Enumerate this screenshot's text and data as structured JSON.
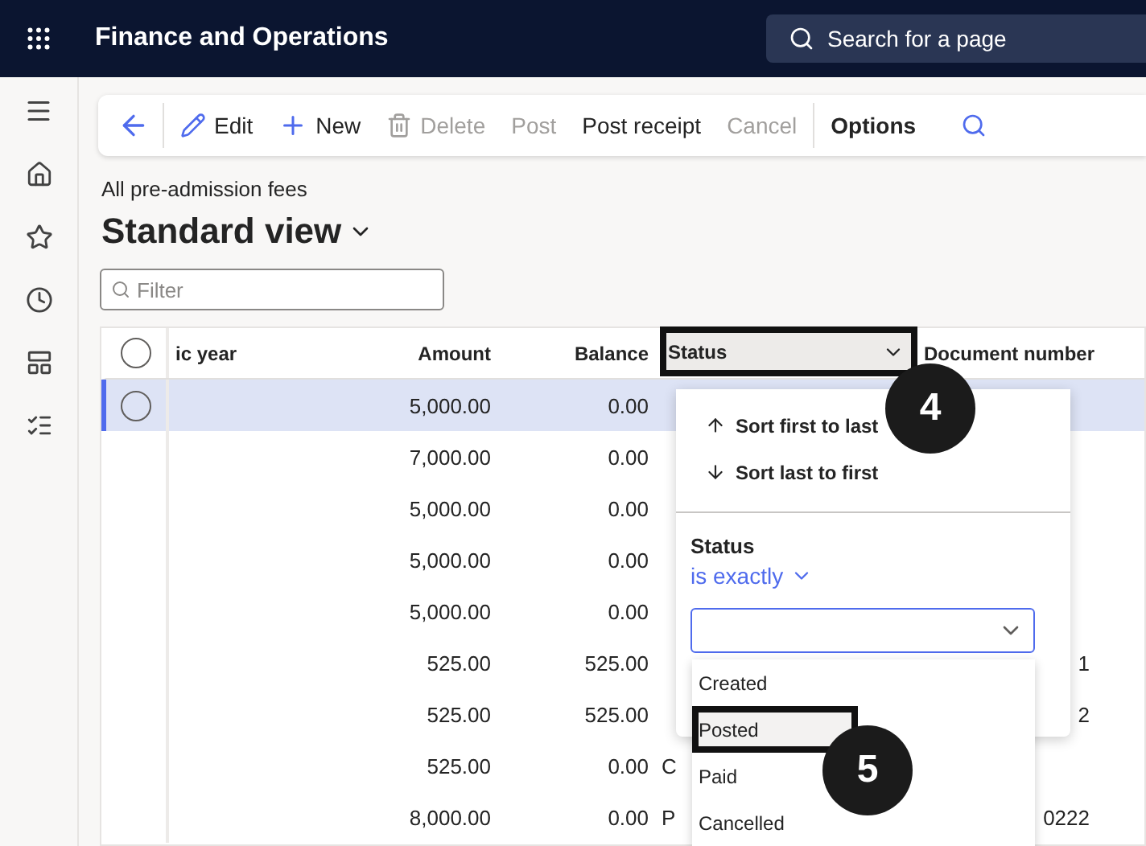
{
  "app_bar": {
    "title": "Finance and Operations",
    "search": {
      "placeholder": "Search for a page"
    }
  },
  "toolbar": {
    "buttons": [
      {
        "label": "Edit",
        "disabled": false
      },
      {
        "label": "New",
        "disabled": false
      },
      {
        "label": "Delete",
        "disabled": true
      },
      {
        "label": "Post",
        "disabled": true
      },
      {
        "label": "Post receipt",
        "disabled": false
      },
      {
        "label": "Cancel",
        "disabled": true
      }
    ],
    "options": "Options"
  },
  "breadcrumb": "All pre-admission fees",
  "view_title": "Standard view",
  "filter": {
    "placeholder": "Filter"
  },
  "grid": {
    "all_selected": false,
    "columns": [
      "ic year",
      "Amount",
      "Balance",
      "Status",
      "Document number"
    ],
    "rows": [
      {
        "selected": true,
        "amount": "5,000.00",
        "balance": "0.00"
      },
      {
        "selected": false,
        "amount": "7,000.00",
        "balance": "0.00"
      },
      {
        "selected": false,
        "amount": "5,000.00",
        "balance": "0.00"
      },
      {
        "selected": false,
        "amount": "5,000.00",
        "balance": "0.00"
      },
      {
        "selected": false,
        "amount": "5,000.00",
        "balance": "0.00"
      },
      {
        "selected": false,
        "amount": "525.00",
        "balance": "525.00",
        "document": "1"
      },
      {
        "selected": false,
        "amount": "525.00",
        "balance": "525.00",
        "document": "2"
      },
      {
        "selected": false,
        "amount": "525.00",
        "balance": "0.00",
        "status": "C"
      },
      {
        "selected": false,
        "amount": "8,000.00",
        "balance": "0.00",
        "status": "P",
        "document": "0222"
      }
    ]
  },
  "column_menu": {
    "sort": [
      "Sort first to last",
      "Sort last to first"
    ],
    "filter_label": "Status",
    "operator": "is exactly",
    "options": [
      {
        "label": "Created",
        "selected": false
      },
      {
        "label": "Posted",
        "selected": true
      },
      {
        "label": "Paid",
        "selected": false
      },
      {
        "label": "Cancelled",
        "selected": false
      }
    ]
  },
  "callouts": [
    "4",
    "5"
  ]
}
